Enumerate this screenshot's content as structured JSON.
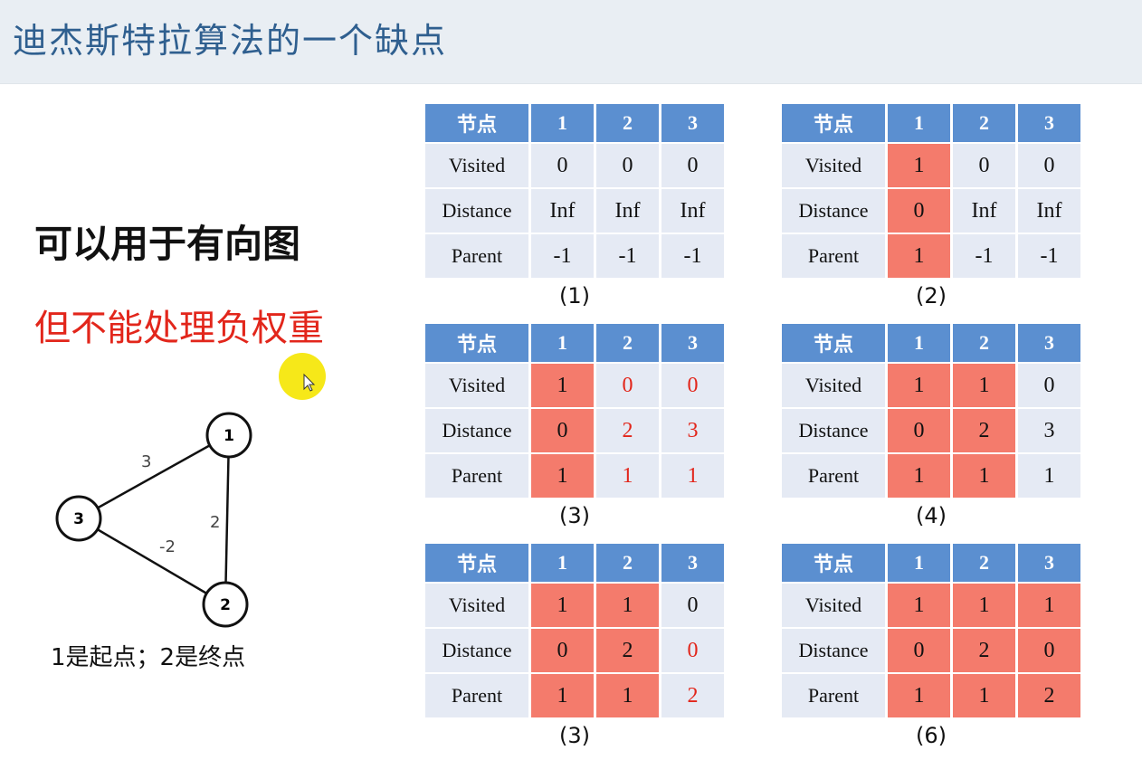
{
  "slide": {
    "title": "迪杰斯特拉算法的一个缺点",
    "point_directed": "可以用于有向图",
    "point_negative": "但不能处理负权重",
    "endpoints_caption": "1是起点；2是终点"
  },
  "graph": {
    "nodes": [
      "1",
      "2",
      "3"
    ],
    "edges": [
      {
        "from": "1",
        "to": "3",
        "weight": "3"
      },
      {
        "from": "1",
        "to": "2",
        "weight": "2"
      },
      {
        "from": "3",
        "to": "2",
        "weight": "-2"
      }
    ]
  },
  "tables": [
    {
      "caption": "(1)",
      "header": [
        "节点",
        "1",
        "2",
        "3"
      ],
      "rows": [
        {
          "label": "Visited",
          "cells": [
            "0",
            "0",
            "0"
          ]
        },
        {
          "label": "Distance",
          "cells": [
            "Inf",
            "Inf",
            "Inf"
          ]
        },
        {
          "label": "Parent",
          "cells": [
            "-1",
            "-1",
            "-1"
          ]
        }
      ]
    },
    {
      "caption": "(2)",
      "header": [
        "节点",
        "1",
        "2",
        "3"
      ],
      "rows": [
        {
          "label": "Visited",
          "cells": [
            "1",
            "0",
            "0"
          ]
        },
        {
          "label": "Distance",
          "cells": [
            "0",
            "Inf",
            "Inf"
          ]
        },
        {
          "label": "Parent",
          "cells": [
            "1",
            "-1",
            "-1"
          ]
        }
      ]
    },
    {
      "caption": "(3)",
      "header": [
        "节点",
        "1",
        "2",
        "3"
      ],
      "rows": [
        {
          "label": "Visited",
          "cells": [
            "1",
            "0",
            "0"
          ]
        },
        {
          "label": "Distance",
          "cells": [
            "0",
            "2",
            "3"
          ]
        },
        {
          "label": "Parent",
          "cells": [
            "1",
            "1",
            "1"
          ]
        }
      ]
    },
    {
      "caption": "(4)",
      "header": [
        "节点",
        "1",
        "2",
        "3"
      ],
      "rows": [
        {
          "label": "Visited",
          "cells": [
            "1",
            "1",
            "0"
          ]
        },
        {
          "label": "Distance",
          "cells": [
            "0",
            "2",
            "3"
          ]
        },
        {
          "label": "Parent",
          "cells": [
            "1",
            "1",
            "1"
          ]
        }
      ]
    },
    {
      "caption": "(3)",
      "header": [
        "节点",
        "1",
        "2",
        "3"
      ],
      "rows": [
        {
          "label": "Visited",
          "cells": [
            "1",
            "1",
            "0"
          ]
        },
        {
          "label": "Distance",
          "cells": [
            "0",
            "2",
            "0"
          ]
        },
        {
          "label": "Parent",
          "cells": [
            "1",
            "1",
            "2"
          ]
        }
      ]
    },
    {
      "caption": "(6)",
      "header": [
        "节点",
        "1",
        "2",
        "3"
      ],
      "rows": [
        {
          "label": "Visited",
          "cells": [
            "1",
            "1",
            "1"
          ]
        },
        {
          "label": "Distance",
          "cells": [
            "0",
            "2",
            "0"
          ]
        },
        {
          "label": "Parent",
          "cells": [
            "1",
            "1",
            "2"
          ]
        }
      ]
    }
  ],
  "colors": {
    "header_bg": "#5b8fd0",
    "cell_bg": "#e5eaf4",
    "highlight": "#f47b6c",
    "red_text": "#e2261b",
    "title_color": "#2f5f8f"
  }
}
